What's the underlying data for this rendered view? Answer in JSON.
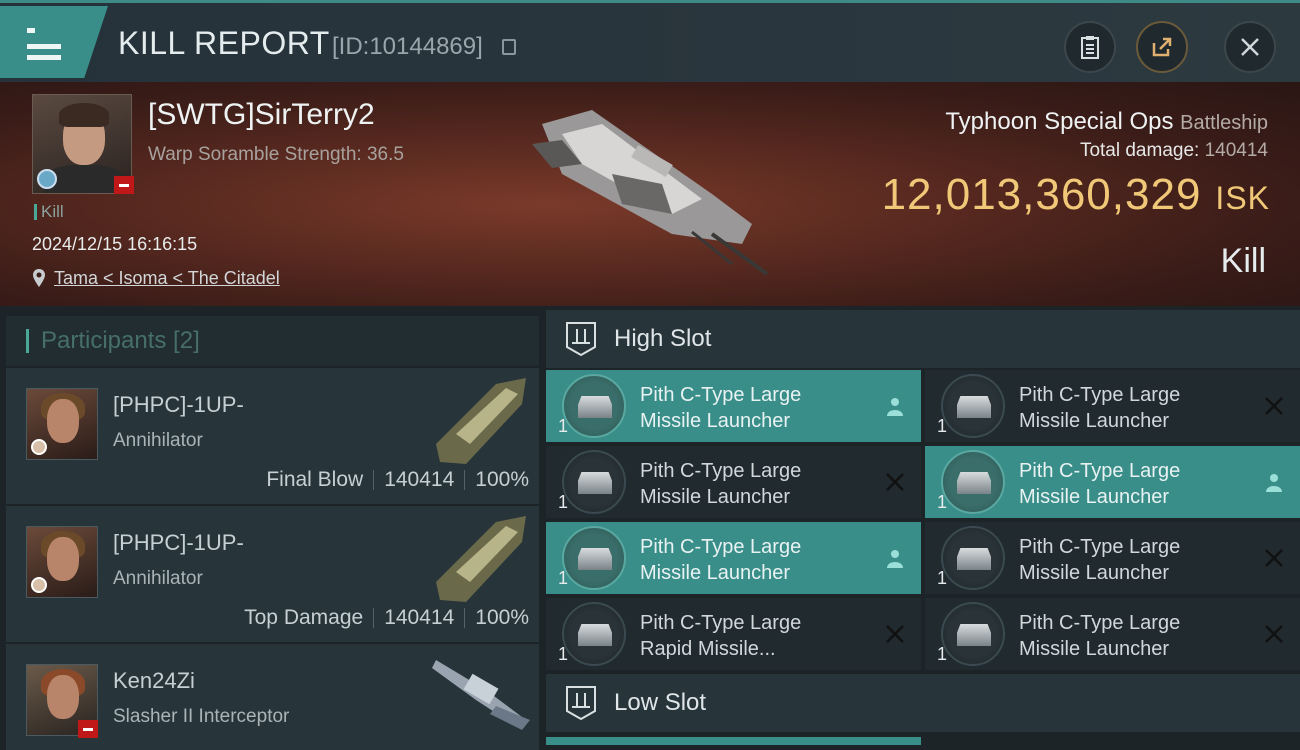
{
  "header": {
    "title": "KILL REPORT",
    "report_id": "[ID:10144869]"
  },
  "victim": {
    "name": "[SWTG]SirTerry2",
    "warp_scramble": "Warp Soramble Strength: 36.5",
    "kill_tag": "Kill",
    "datetime": "2024/12/15 16:16:15",
    "location": "Tama < Isoma < The Citadel",
    "ship_name": "Typhoon Special Ops",
    "ship_class": "Battleship",
    "total_damage_label": "Total damage:",
    "total_damage": "140414",
    "isk_value": "12,013,360,329",
    "isk_unit": "ISK",
    "result": "Kill"
  },
  "participants": {
    "title": "Participants [2]",
    "rows": [
      {
        "name": "[PHPC]-1UP-",
        "ship": "Annihilator",
        "role": "Final Blow",
        "damage": "140414",
        "percent": "100%"
      },
      {
        "name": "[PHPC]-1UP-",
        "ship": "Annihilator",
        "role": "Top Damage",
        "damage": "140414",
        "percent": "100%"
      },
      {
        "name": "Ken24Zi",
        "ship": "Slasher II Interceptor",
        "role": "",
        "damage": "",
        "percent": ""
      }
    ]
  },
  "slots": {
    "high_label": "High Slot",
    "low_label": "Low Slot",
    "high": [
      {
        "line1": "Pith C-Type Large",
        "line2": "Missile Launcher",
        "qty": "1",
        "state": "fitted"
      },
      {
        "line1": "Pith C-Type Large",
        "line2": "Missile Launcher",
        "qty": "1",
        "state": "destroyed"
      },
      {
        "line1": "Pith C-Type Large",
        "line2": "Missile Launcher",
        "qty": "1",
        "state": "destroyed"
      },
      {
        "line1": "Pith C-Type Large",
        "line2": "Missile Launcher",
        "qty": "1",
        "state": "fitted"
      },
      {
        "line1": "Pith C-Type Large",
        "line2": "Missile Launcher",
        "qty": "1",
        "state": "fitted"
      },
      {
        "line1": "Pith C-Type Large",
        "line2": "Missile Launcher",
        "qty": "1",
        "state": "destroyed"
      },
      {
        "line1": "Pith C-Type Large",
        "line2": "Rapid Missile...",
        "qty": "1",
        "state": "destroyed"
      },
      {
        "line1": "Pith C-Type Large",
        "line2": "Missile Launcher",
        "qty": "1",
        "state": "destroyed"
      }
    ]
  },
  "colors": {
    "accent": "#3a8e89",
    "isk": "#f0c878",
    "minus_badge": "#c01818"
  },
  "icons": [
    "menu-icon",
    "copy-icon",
    "clipboard-icon",
    "share-icon",
    "close-icon",
    "location-pin-icon",
    "high-slot-icon",
    "low-slot-icon",
    "pilot-icon",
    "x-icon"
  ]
}
